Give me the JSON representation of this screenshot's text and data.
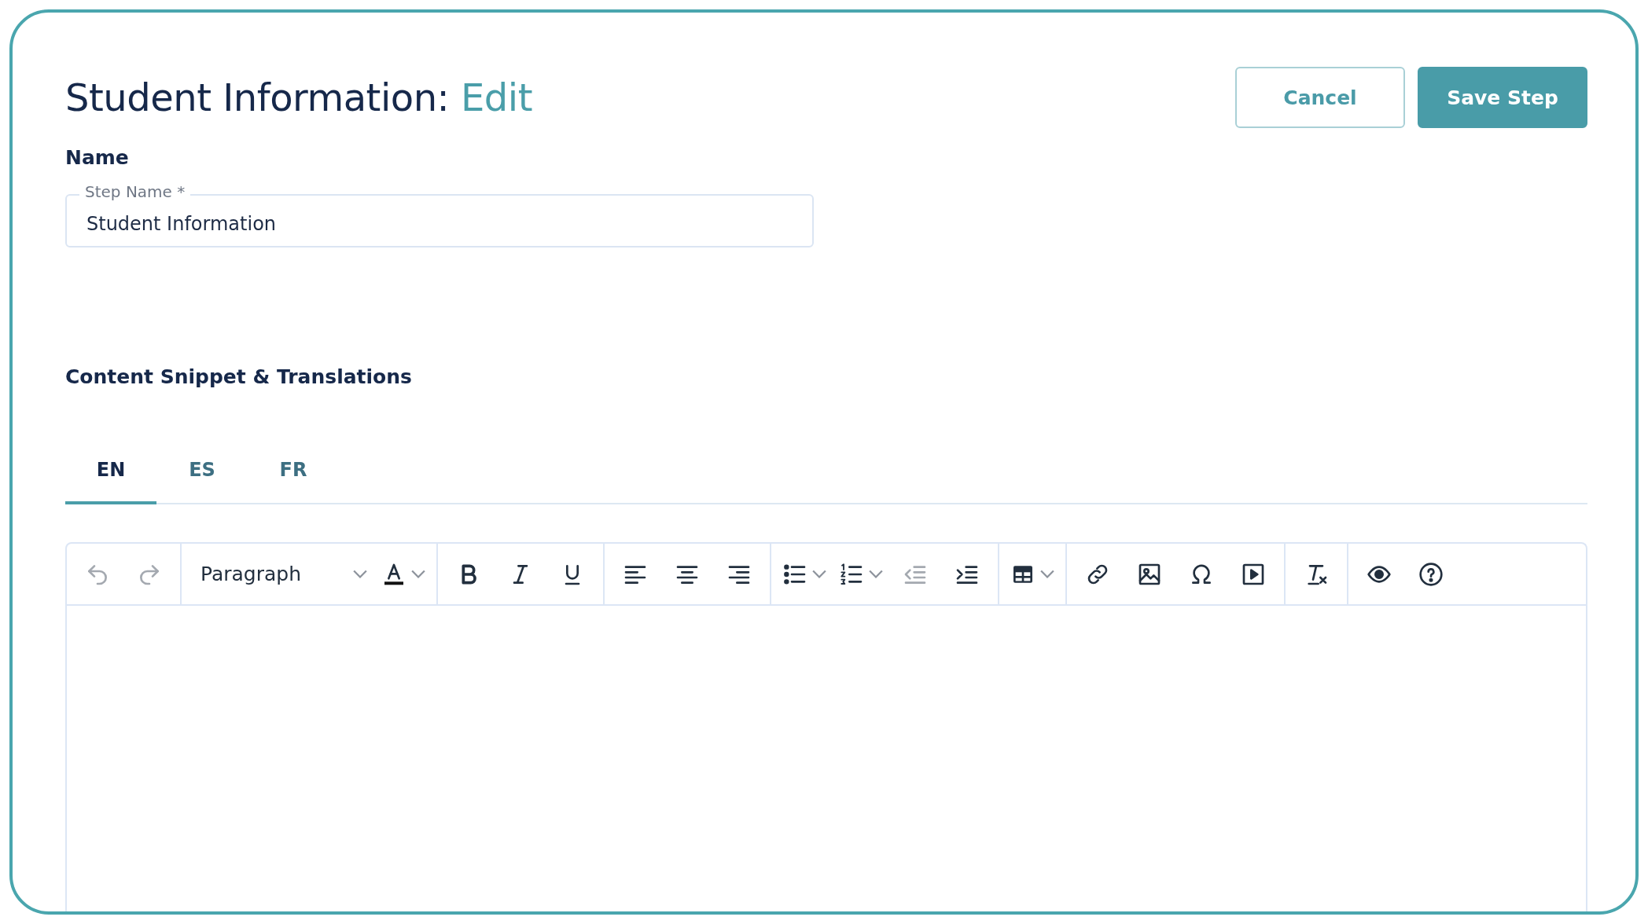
{
  "header": {
    "title": "Student Information:",
    "mode": "Edit",
    "buttons": [
      {
        "label": "Cancel",
        "kind": "secondary"
      },
      {
        "label": "Save Step",
        "kind": "primary"
      }
    ]
  },
  "name_section": {
    "heading": "Name",
    "field": {
      "label": "Step Name *",
      "value": "Student Information"
    }
  },
  "content_section": {
    "heading": "Content Snippet & Translations",
    "tabs": [
      {
        "label": "EN",
        "selected": true
      },
      {
        "label": "ES",
        "selected": false
      },
      {
        "label": "FR",
        "selected": false
      }
    ],
    "toolbar": [
      [
        {
          "kind": "undo",
          "disabled": true
        },
        {
          "kind": "redo",
          "disabled": true
        }
      ],
      [
        {
          "kind": "select",
          "value": "Paragraph",
          "menu": true
        },
        {
          "kind": "text-color",
          "menu": true
        }
      ],
      [
        {
          "kind": "bold"
        },
        {
          "kind": "italic"
        },
        {
          "kind": "underline"
        }
      ],
      [
        {
          "kind": "align-left"
        },
        {
          "kind": "align-center"
        },
        {
          "kind": "align-right"
        }
      ],
      [
        {
          "kind": "bullet-list",
          "menu": true
        },
        {
          "kind": "numbered-list",
          "menu": true
        },
        {
          "kind": "outdent",
          "disabled": true
        },
        {
          "kind": "indent"
        }
      ],
      [
        {
          "kind": "table",
          "menu": true
        }
      ],
      [
        {
          "kind": "link"
        },
        {
          "kind": "image"
        },
        {
          "kind": "special-character"
        },
        {
          "kind": "media"
        }
      ],
      [
        {
          "kind": "clear-format"
        }
      ],
      [
        {
          "kind": "preview"
        },
        {
          "kind": "help"
        }
      ]
    ]
  }
}
